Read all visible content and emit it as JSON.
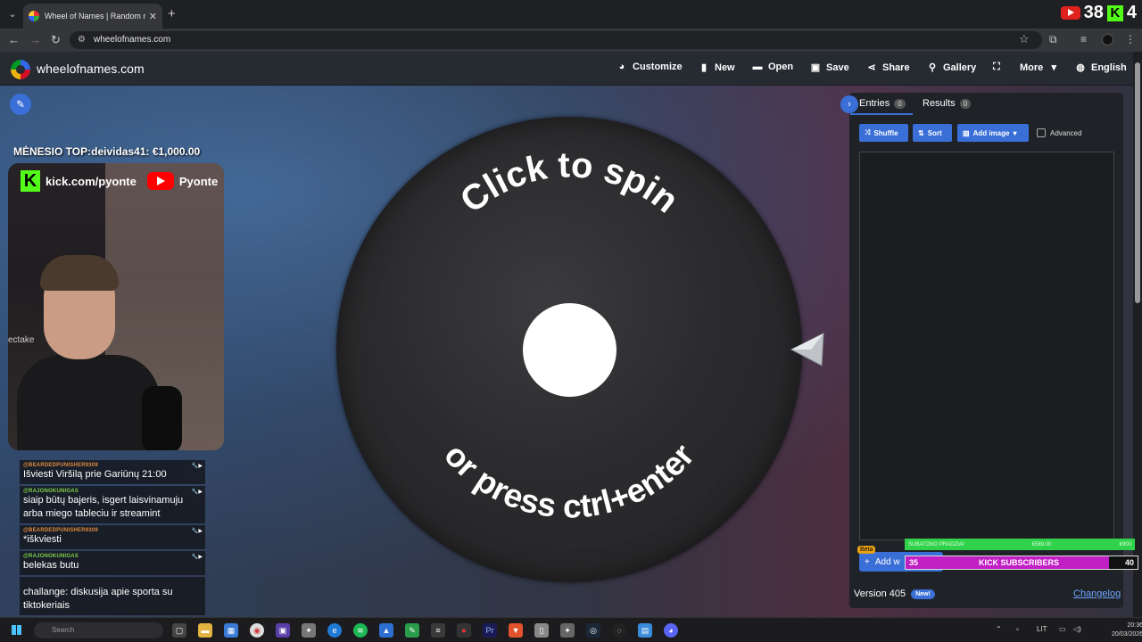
{
  "browser": {
    "tab_title": "Wheel of Names | Random nam",
    "url": "wheelofnames.com",
    "youtube_count": "38",
    "kick_count": "4",
    "kick_letter": "K"
  },
  "header": {
    "brand": "wheelofnames.com",
    "menu": [
      {
        "label": "Customize",
        "icon": "palette-icon"
      },
      {
        "label": "New",
        "icon": "file-icon"
      },
      {
        "label": "Open",
        "icon": "folder-icon"
      },
      {
        "label": "Save",
        "icon": "save-icon"
      },
      {
        "label": "Share",
        "icon": "share-icon"
      },
      {
        "label": "Gallery",
        "icon": "search-icon"
      },
      {
        "label": "",
        "icon": "fullscreen-icon"
      },
      {
        "label": "More",
        "icon": "chevron-down-icon"
      },
      {
        "label": "English",
        "icon": "globe-icon"
      }
    ]
  },
  "stream": {
    "top_line": "MĖNESIO TOP:deividas41: €1,000.00",
    "kick_url": "kick.com/pyonte",
    "youtube_name": "Pyonte",
    "cam_side_text": "ectake"
  },
  "chat": [
    {
      "user": "@BEARDEDPUNISHER9309",
      "user_color": "#e08a3a",
      "text": "Išviesti Viršilą prie Gariūnų 21:00"
    },
    {
      "user": "@RAJONOKUNIGAS",
      "user_color": "#7fd14a",
      "text": "siaip būtų bajeris, isgert laisvinamuju arba miego tableciu ir streamint"
    },
    {
      "user": "@BEARDEDPUNISHER9309",
      "user_color": "#e08a3a",
      "text": "*iškviesti"
    },
    {
      "user": "@RAJONOKUNIGAS",
      "user_color": "#7fd14a",
      "text": "belekas butu"
    },
    {
      "user": "",
      "user_color": "#e03a3a",
      "text": "challange: diskusija apie sporta su tiktokeriais"
    }
  ],
  "wheel": {
    "top_text": "Click to spin",
    "bottom_text": "or press ctrl+enter"
  },
  "panel": {
    "tabs": [
      {
        "label": "Entries",
        "count": "0"
      },
      {
        "label": "Results",
        "count": "0"
      }
    ],
    "buttons": {
      "shuffle": "Shuffle",
      "sort": "Sort",
      "add_image": "Add image"
    },
    "advanced_label": "Advanced",
    "add_label": "Add w",
    "beta": "Beta",
    "version": "Version 405",
    "new_badge": "New!",
    "changelog": "Changelog"
  },
  "overlay": {
    "green_left": "SUBATONO PRADZIAI",
    "green_mid": "€589.00",
    "green_right": "€900",
    "kick_left": "35",
    "kick_label": "KICK SUBSCRIBERS",
    "kick_right": "40"
  },
  "taskbar": {
    "search_placeholder": "Search",
    "language": "LIT",
    "time": "20:36",
    "date": "20/03/2026"
  }
}
